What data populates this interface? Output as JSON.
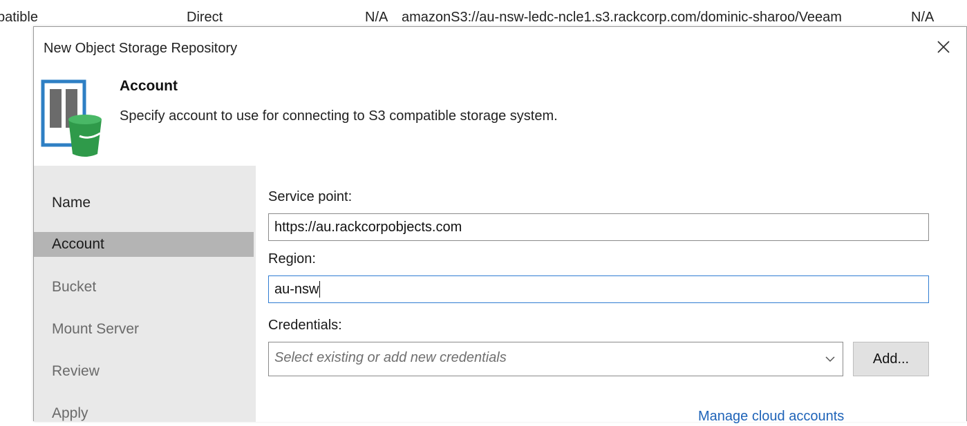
{
  "background_row": {
    "type": "patible",
    "mode": "Direct",
    "na1": "N/A",
    "path": "amazonS3://au-nsw-ledc-ncle1.s3.rackcorp.com/dominic-sharoo/Veeam",
    "na2": "N/A"
  },
  "dialog": {
    "title": "New Object Storage Repository",
    "close_icon": "close-icon",
    "header": {
      "icon": "object-storage-bucket-icon",
      "step_title": "Account",
      "step_description": "Specify account to use for connecting to S3 compatible storage system."
    },
    "nav": {
      "items": [
        {
          "label": "Name"
        },
        {
          "label": "Account",
          "active": true
        },
        {
          "label": "Bucket"
        },
        {
          "label": "Mount Server"
        },
        {
          "label": "Review"
        },
        {
          "label": "Apply"
        }
      ]
    },
    "form": {
      "service_point_label": "Service point:",
      "service_point_value": "https://au.rackcorpobjects.com",
      "region_label": "Region:",
      "region_value": "au-nsw",
      "credentials_label": "Credentials:",
      "credentials_placeholder": "Select existing or add new credentials",
      "add_button": "Add...",
      "manage_link": "Manage cloud accounts"
    }
  },
  "colors": {
    "accent_focus": "#2f7cd2",
    "link": "#1e63b8",
    "nav_background": "#e9e9e9",
    "nav_active": "#b4b4b4",
    "icon_blue": "#2e7fc4",
    "icon_green": "#2f9a4a"
  }
}
